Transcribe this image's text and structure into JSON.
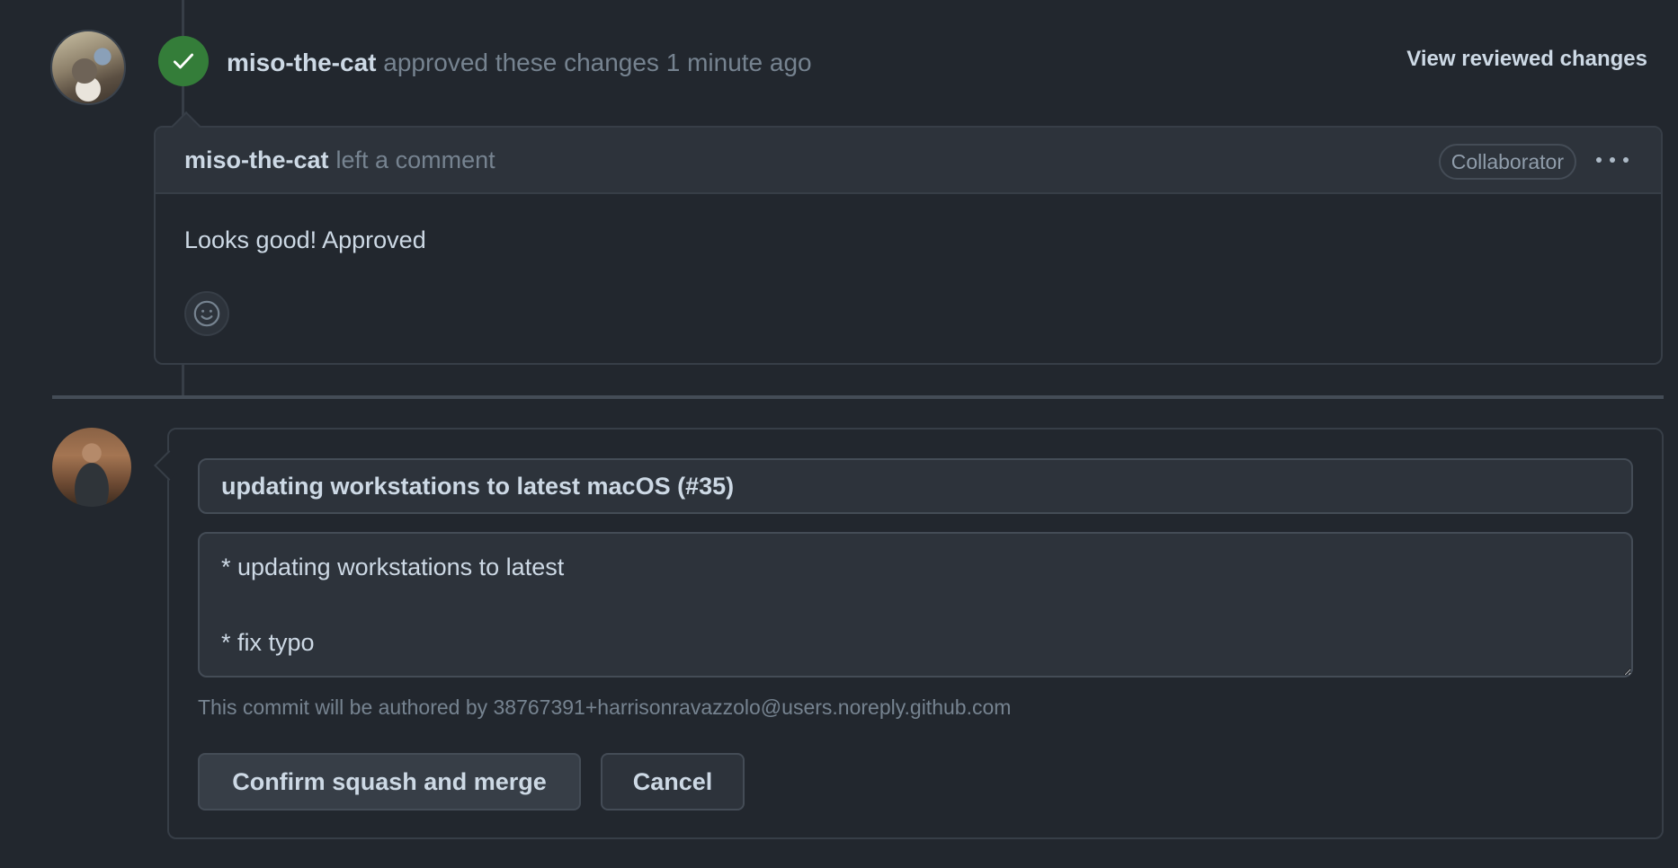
{
  "review": {
    "reviewer": "miso-the-cat",
    "action_text": "approved these changes",
    "time_ago": "1 minute ago",
    "view_changes_label": "View reviewed changes",
    "status_icon": "check-icon",
    "status_color": "#347d39"
  },
  "comment": {
    "author": "miso-the-cat",
    "action_text": "left a comment",
    "role_badge": "Collaborator",
    "menu_icon": "kebab-horizontal-icon",
    "body": "Looks good! Approved",
    "reaction_icon": "smiley-icon"
  },
  "merge_form": {
    "commit_title": "updating workstations to latest macOS (#35)",
    "commit_body": "* updating workstations to latest\n\n* fix typo",
    "author_note": "This commit will be authored by 38767391+harrisonravazzolo@users.noreply.github.com",
    "confirm_label": "Confirm squash and merge",
    "cancel_label": "Cancel"
  }
}
